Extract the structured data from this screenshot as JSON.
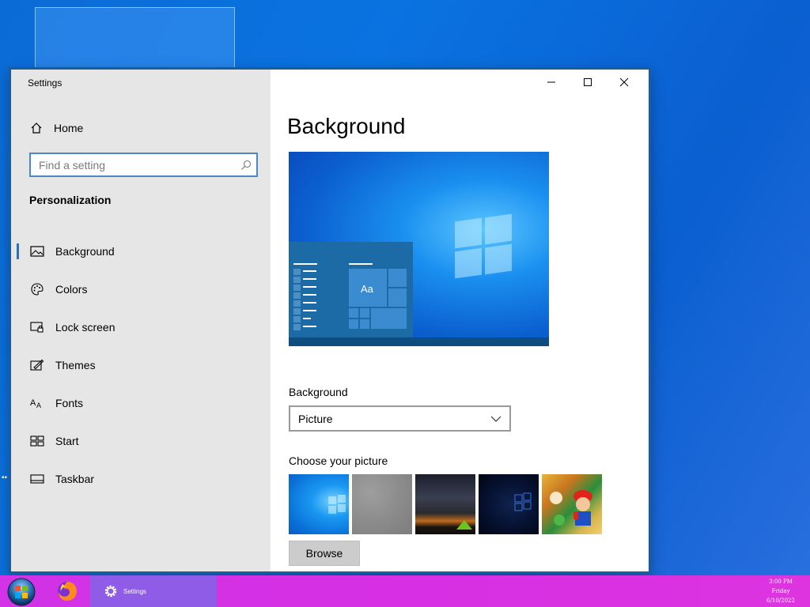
{
  "window": {
    "title": "Settings"
  },
  "sidebar": {
    "home_label": "Home",
    "search_placeholder": "Find a setting",
    "section_title": "Personalization",
    "items": [
      {
        "label": "Background",
        "icon": "image-icon",
        "active": true
      },
      {
        "label": "Colors",
        "icon": "palette-icon",
        "active": false
      },
      {
        "label": "Lock screen",
        "icon": "lock-screen-icon",
        "active": false
      },
      {
        "label": "Themes",
        "icon": "themes-icon",
        "active": false
      },
      {
        "label": "Fonts",
        "icon": "fonts-icon",
        "active": false
      },
      {
        "label": "Start",
        "icon": "start-icon",
        "active": false
      },
      {
        "label": "Taskbar",
        "icon": "taskbar-icon",
        "active": false
      }
    ]
  },
  "main": {
    "title": "Background",
    "preview_tile_text": "Aa",
    "background_label": "Background",
    "background_selected": "Picture",
    "choose_label": "Choose your picture",
    "thumbnails": [
      "windows-blue-wallpaper",
      "gray-texture",
      "night-sky-tent",
      "dark-windows-logo",
      "mario-game-art"
    ],
    "browse_label": "Browse"
  },
  "taskbar": {
    "settings_label": "Settings",
    "clock_time": "3:00 PM",
    "clock_day": "Friday",
    "clock_date": "6/10/2022"
  },
  "colors": {
    "accent": "#2f6fb6",
    "taskbar": "#d233e6",
    "active_task": "#8e5ce6"
  }
}
